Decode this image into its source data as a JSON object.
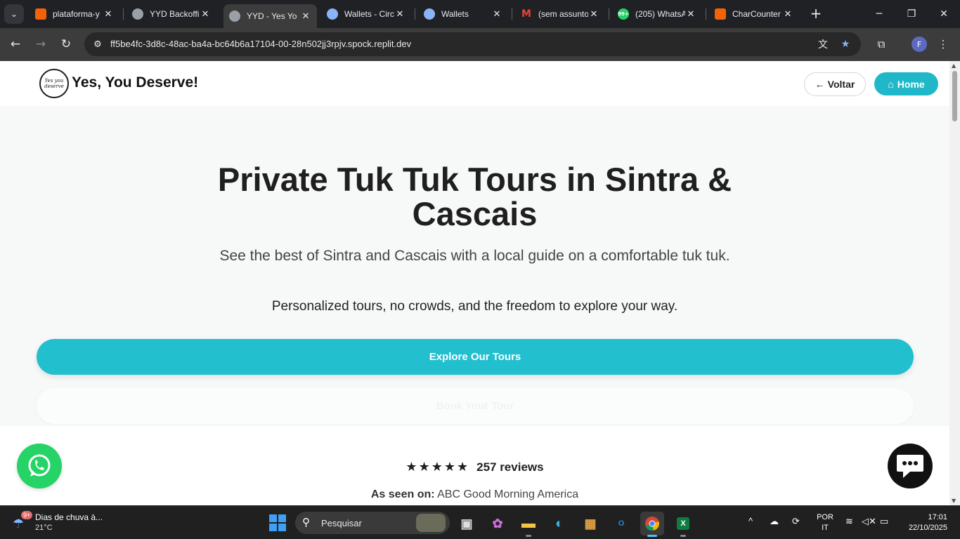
{
  "browser": {
    "tabs": [
      {
        "title": "plataforma-y",
        "favicon": "replit-icon",
        "color": "#f26207"
      },
      {
        "title": "YYD Backoffi",
        "favicon": "globe-icon",
        "color": "#9aa0a6"
      },
      {
        "title": "YYD - Yes Yo",
        "favicon": "globe-icon",
        "color": "#9aa0a6",
        "active": true
      },
      {
        "title": "Wallets - Circ",
        "favicon": "circle-icon",
        "color": "#8ab4f8"
      },
      {
        "title": "Wallets",
        "favicon": "circle-icon",
        "color": "#8ab4f8"
      },
      {
        "title": "(sem assunto",
        "favicon": "gmail-icon",
        "color": "#ea4335"
      },
      {
        "title": "(205) WhatsA",
        "favicon": "whatsapp-icon",
        "color": "#25d366",
        "badge": "99+"
      },
      {
        "title": "CharCounter",
        "favicon": "charcounter-icon",
        "color": "#f26207"
      }
    ],
    "url": "ff5be4fc-3d8c-48ac-ba4a-bc64b6a17104-00-28n502jj3rpjv.spock.replit.dev",
    "profile_initial": "F"
  },
  "site": {
    "brand": "Yes, You Deserve!",
    "logo_text": "Yes you deserve",
    "back_label": "Voltar",
    "home_label": "Home",
    "hero_title": "Private Tuk Tuk Tours in Sintra & Cascais",
    "hero_subtitle": "See the best of Sintra and Cascais with a local guide on a comfortable tuk tuk.",
    "hero_tagline": "Personalized tours, no crowds, and the freedom to explore your way.",
    "cta_primary": "Explore Our Tours",
    "cta_secondary": "Book Your Tour",
    "rating_stars": "★★★★★",
    "reviews": "257 reviews",
    "seen_on_label": "As seen on:",
    "seen_on_value": "ABC Good Morning America",
    "accent_color": "#22bfcf"
  },
  "taskbar": {
    "weather_title": "Dias de chuva à...",
    "weather_temp": "21°C",
    "weather_badge": "9+",
    "search_placeholder": "Pesquisar",
    "lang_top": "POR",
    "lang_bottom": "IT",
    "time": "17:01",
    "date": "22/10/2025"
  }
}
